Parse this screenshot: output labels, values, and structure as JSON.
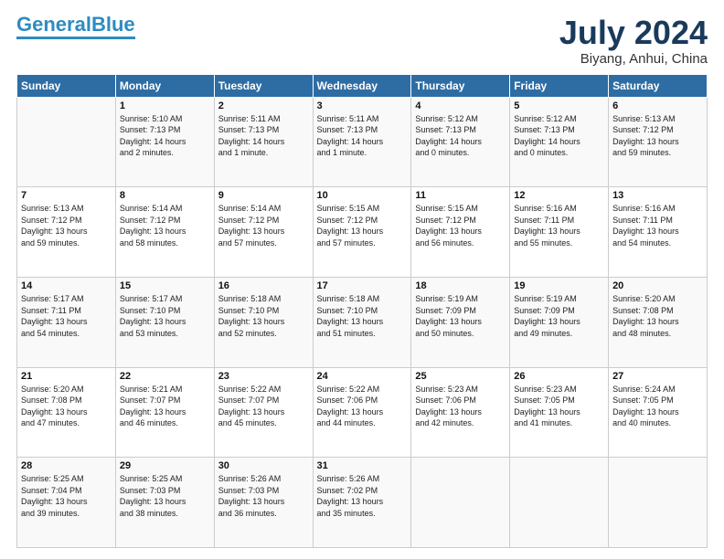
{
  "header": {
    "logo_general": "General",
    "logo_blue": "Blue",
    "title": "July 2024",
    "subtitle": "Biyang, Anhui, China"
  },
  "weekdays": [
    "Sunday",
    "Monday",
    "Tuesday",
    "Wednesday",
    "Thursday",
    "Friday",
    "Saturday"
  ],
  "weeks": [
    [
      {
        "day": "",
        "info": ""
      },
      {
        "day": "1",
        "info": "Sunrise: 5:10 AM\nSunset: 7:13 PM\nDaylight: 14 hours\nand 2 minutes."
      },
      {
        "day": "2",
        "info": "Sunrise: 5:11 AM\nSunset: 7:13 PM\nDaylight: 14 hours\nand 1 minute."
      },
      {
        "day": "3",
        "info": "Sunrise: 5:11 AM\nSunset: 7:13 PM\nDaylight: 14 hours\nand 1 minute."
      },
      {
        "day": "4",
        "info": "Sunrise: 5:12 AM\nSunset: 7:13 PM\nDaylight: 14 hours\nand 0 minutes."
      },
      {
        "day": "5",
        "info": "Sunrise: 5:12 AM\nSunset: 7:13 PM\nDaylight: 14 hours\nand 0 minutes."
      },
      {
        "day": "6",
        "info": "Sunrise: 5:13 AM\nSunset: 7:12 PM\nDaylight: 13 hours\nand 59 minutes."
      }
    ],
    [
      {
        "day": "7",
        "info": "Sunrise: 5:13 AM\nSunset: 7:12 PM\nDaylight: 13 hours\nand 59 minutes."
      },
      {
        "day": "8",
        "info": "Sunrise: 5:14 AM\nSunset: 7:12 PM\nDaylight: 13 hours\nand 58 minutes."
      },
      {
        "day": "9",
        "info": "Sunrise: 5:14 AM\nSunset: 7:12 PM\nDaylight: 13 hours\nand 57 minutes."
      },
      {
        "day": "10",
        "info": "Sunrise: 5:15 AM\nSunset: 7:12 PM\nDaylight: 13 hours\nand 57 minutes."
      },
      {
        "day": "11",
        "info": "Sunrise: 5:15 AM\nSunset: 7:12 PM\nDaylight: 13 hours\nand 56 minutes."
      },
      {
        "day": "12",
        "info": "Sunrise: 5:16 AM\nSunset: 7:11 PM\nDaylight: 13 hours\nand 55 minutes."
      },
      {
        "day": "13",
        "info": "Sunrise: 5:16 AM\nSunset: 7:11 PM\nDaylight: 13 hours\nand 54 minutes."
      }
    ],
    [
      {
        "day": "14",
        "info": "Sunrise: 5:17 AM\nSunset: 7:11 PM\nDaylight: 13 hours\nand 54 minutes."
      },
      {
        "day": "15",
        "info": "Sunrise: 5:17 AM\nSunset: 7:10 PM\nDaylight: 13 hours\nand 53 minutes."
      },
      {
        "day": "16",
        "info": "Sunrise: 5:18 AM\nSunset: 7:10 PM\nDaylight: 13 hours\nand 52 minutes."
      },
      {
        "day": "17",
        "info": "Sunrise: 5:18 AM\nSunset: 7:10 PM\nDaylight: 13 hours\nand 51 minutes."
      },
      {
        "day": "18",
        "info": "Sunrise: 5:19 AM\nSunset: 7:09 PM\nDaylight: 13 hours\nand 50 minutes."
      },
      {
        "day": "19",
        "info": "Sunrise: 5:19 AM\nSunset: 7:09 PM\nDaylight: 13 hours\nand 49 minutes."
      },
      {
        "day": "20",
        "info": "Sunrise: 5:20 AM\nSunset: 7:08 PM\nDaylight: 13 hours\nand 48 minutes."
      }
    ],
    [
      {
        "day": "21",
        "info": "Sunrise: 5:20 AM\nSunset: 7:08 PM\nDaylight: 13 hours\nand 47 minutes."
      },
      {
        "day": "22",
        "info": "Sunrise: 5:21 AM\nSunset: 7:07 PM\nDaylight: 13 hours\nand 46 minutes."
      },
      {
        "day": "23",
        "info": "Sunrise: 5:22 AM\nSunset: 7:07 PM\nDaylight: 13 hours\nand 45 minutes."
      },
      {
        "day": "24",
        "info": "Sunrise: 5:22 AM\nSunset: 7:06 PM\nDaylight: 13 hours\nand 44 minutes."
      },
      {
        "day": "25",
        "info": "Sunrise: 5:23 AM\nSunset: 7:06 PM\nDaylight: 13 hours\nand 42 minutes."
      },
      {
        "day": "26",
        "info": "Sunrise: 5:23 AM\nSunset: 7:05 PM\nDaylight: 13 hours\nand 41 minutes."
      },
      {
        "day": "27",
        "info": "Sunrise: 5:24 AM\nSunset: 7:05 PM\nDaylight: 13 hours\nand 40 minutes."
      }
    ],
    [
      {
        "day": "28",
        "info": "Sunrise: 5:25 AM\nSunset: 7:04 PM\nDaylight: 13 hours\nand 39 minutes."
      },
      {
        "day": "29",
        "info": "Sunrise: 5:25 AM\nSunset: 7:03 PM\nDaylight: 13 hours\nand 38 minutes."
      },
      {
        "day": "30",
        "info": "Sunrise: 5:26 AM\nSunset: 7:03 PM\nDaylight: 13 hours\nand 36 minutes."
      },
      {
        "day": "31",
        "info": "Sunrise: 5:26 AM\nSunset: 7:02 PM\nDaylight: 13 hours\nand 35 minutes."
      },
      {
        "day": "",
        "info": ""
      },
      {
        "day": "",
        "info": ""
      },
      {
        "day": "",
        "info": ""
      }
    ]
  ]
}
